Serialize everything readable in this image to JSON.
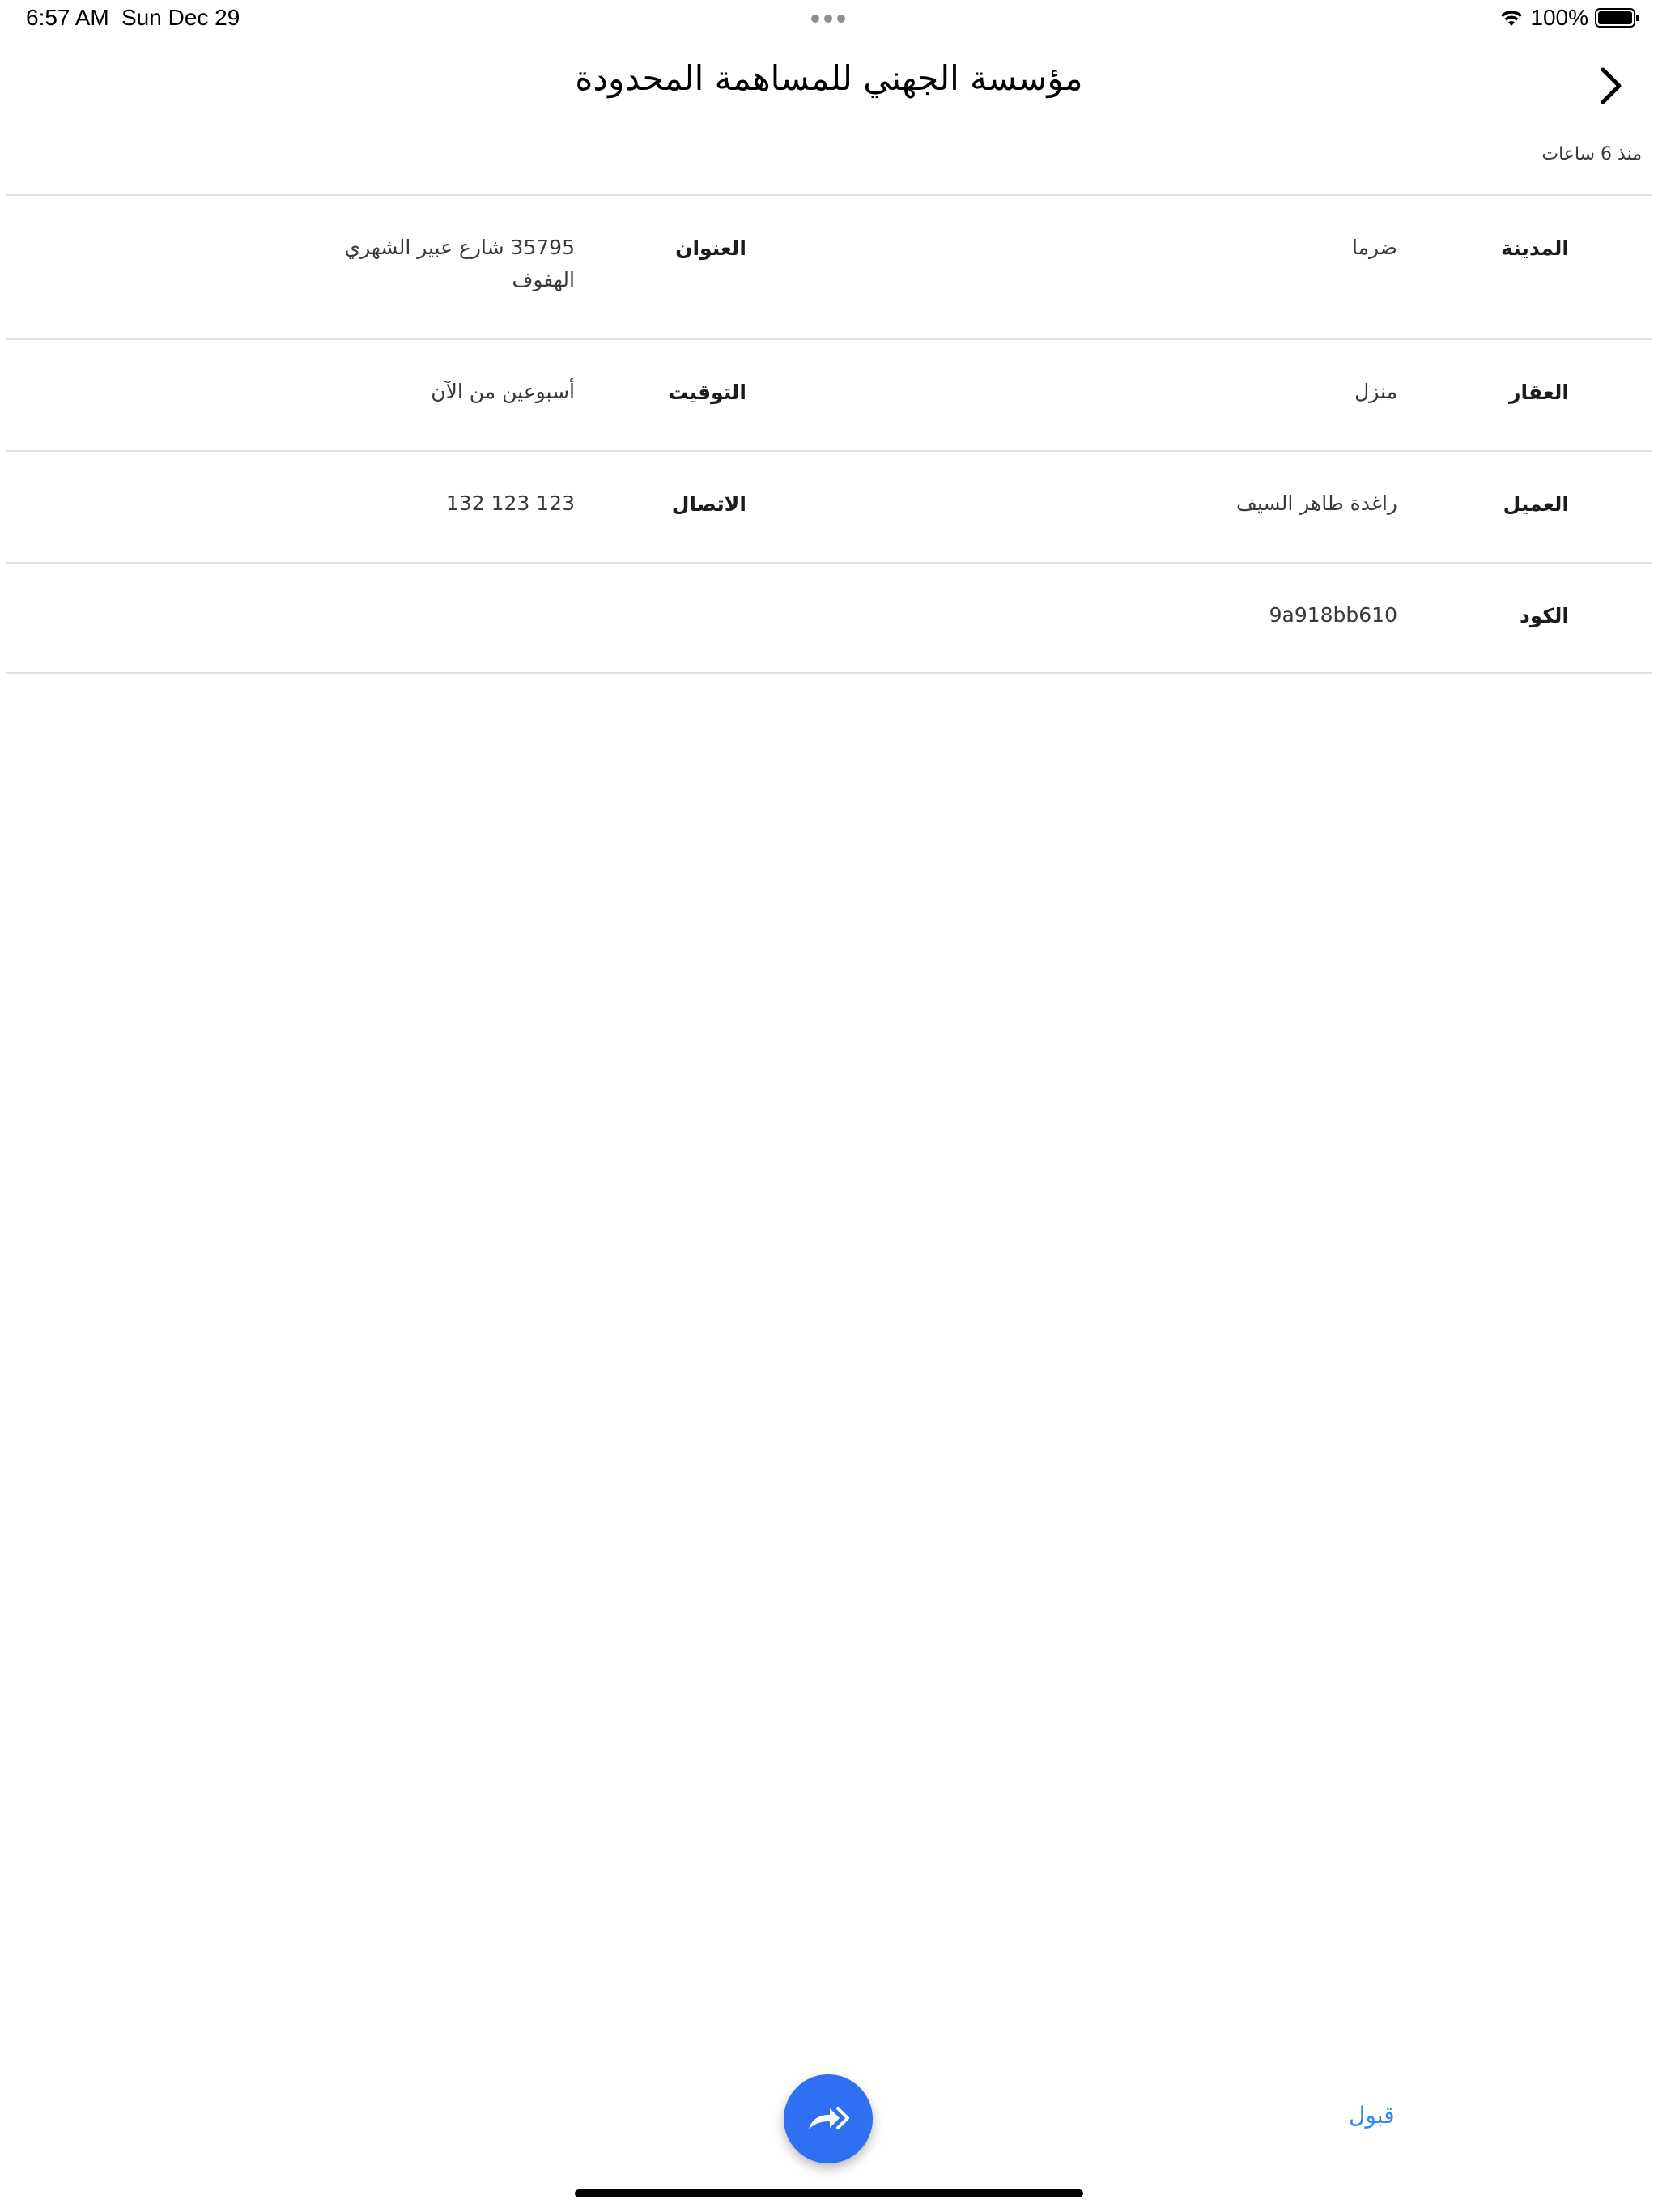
{
  "status_bar": {
    "time": "6:57 AM",
    "date": "Sun Dec 29",
    "battery": "100%"
  },
  "header": {
    "title": "مؤسسة الجهني للمساهمة المحدودة",
    "back_icon": "chevron-right-icon",
    "time_ago": "منذ 6 ساعات"
  },
  "details": {
    "city": {
      "label": "المدينة",
      "value": "ضرما"
    },
    "address": {
      "label": "العنوان",
      "value_line1": "35795 شارع عبير الشهري",
      "value_line2": "الهفوف"
    },
    "property": {
      "label": "العقار",
      "value": "منزل"
    },
    "timing": {
      "label": "التوقيت",
      "value": "أسبوعين من الآن"
    },
    "client": {
      "label": "العميل",
      "value": "راغدة طاهر السيف"
    },
    "contact": {
      "label": "الاتصال",
      "value": "132 123 123"
    },
    "code": {
      "label": "الكود",
      "value": "9a918bb610"
    }
  },
  "actions": {
    "accept_label": "قبول",
    "fab_icon": "forward-arrows-icon",
    "fab_color": "#2f6ff2",
    "accent_color": "#2f86f2"
  }
}
